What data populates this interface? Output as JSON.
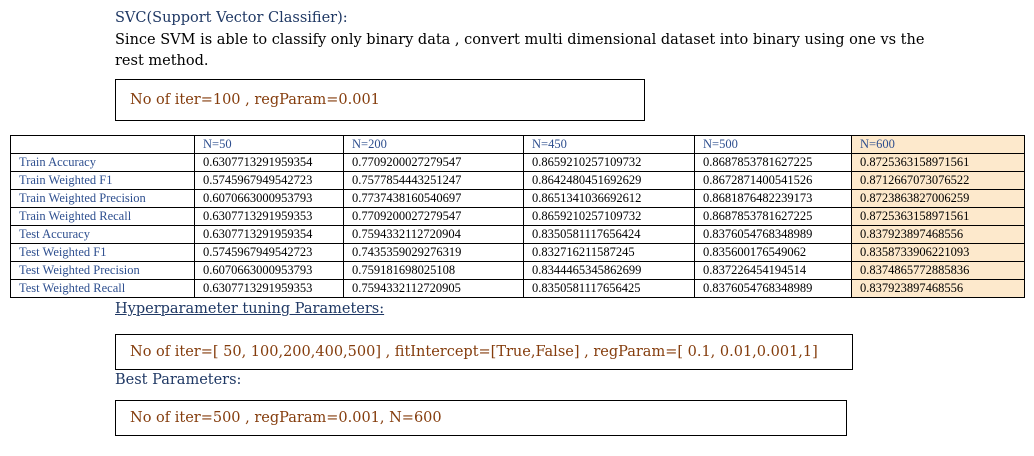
{
  "document": {
    "heading": "SVC(Support Vector Classifier):",
    "description": "Since SVM is able to classify only binary data , convert multi dimensional dataset into binary using one vs the rest method.",
    "config_box": "No of iter=100 , regParam=0.001",
    "hyperparameter_heading": "Hyperparameter tuning Parameters:",
    "hyperparameter_box": "No of iter=[ 50, 100,200,400,500] , fitIntercept=[True,False] , regParam=[ 0.1, 0.01,0.001,1]",
    "best_heading": "Best Parameters:",
    "best_box": "No of iter=500 , regParam=0.001, N=600"
  },
  "table": {
    "columns": [
      "",
      "N=50",
      "N=200",
      "N=450",
      "N=500",
      "N=600"
    ],
    "rows": [
      {
        "label": "Train Accuracy",
        "values": [
          "0.6307713291959354",
          "0.7709200027279547",
          "0.8659210257109732",
          "0.8687853781627225",
          "0.8725363158971561"
        ]
      },
      {
        "label": "Train Weighted F1",
        "values": [
          "0.5745967949542723",
          "0.7577854443251247",
          "0.8642480451692629",
          "0.8672871400541526",
          "0.8712667073076522"
        ]
      },
      {
        "label": "Train Weighted Precision",
        "values": [
          "0.6070663000953793",
          "0.7737438160540697",
          "0.8651341036692612",
          "0.8681876482239173",
          "0.8723863827006259"
        ]
      },
      {
        "label": "Train Weighted Recall",
        "values": [
          "0.6307713291959353",
          "0.7709200027279547",
          "0.8659210257109732",
          "0.8687853781627225",
          "0.8725363158971561"
        ]
      },
      {
        "label": "Test Accuracy",
        "values": [
          "0.6307713291959354",
          "0.7594332112720904",
          "0.8350581117656424",
          "0.8376054768348989",
          "0.837923897468556"
        ]
      },
      {
        "label": "Test Weighted F1",
        "values": [
          "0.5745967949542723",
          "0.7435359029276319",
          "0.832716211587245",
          "0.835600176549062",
          "0.8358733906221093"
        ]
      },
      {
        "label": "Test Weighted Precision",
        "values": [
          "0.6070663000953793",
          "0.759181698025108",
          "0.8344465345862699",
          "0.837226454194514",
          "0.8374865772885836"
        ]
      },
      {
        "label": "Test Weighted Recall",
        "values": [
          "0.6307713291959353",
          "0.7594332112720905",
          "0.8350581117656425",
          "0.8376054768348989",
          "0.837923897468556"
        ]
      }
    ]
  },
  "colors": {
    "heading": "#1f3864",
    "box_text": "#843c0c",
    "table_label": "#2e4f8f",
    "highlight_column": "#fde9cc"
  }
}
